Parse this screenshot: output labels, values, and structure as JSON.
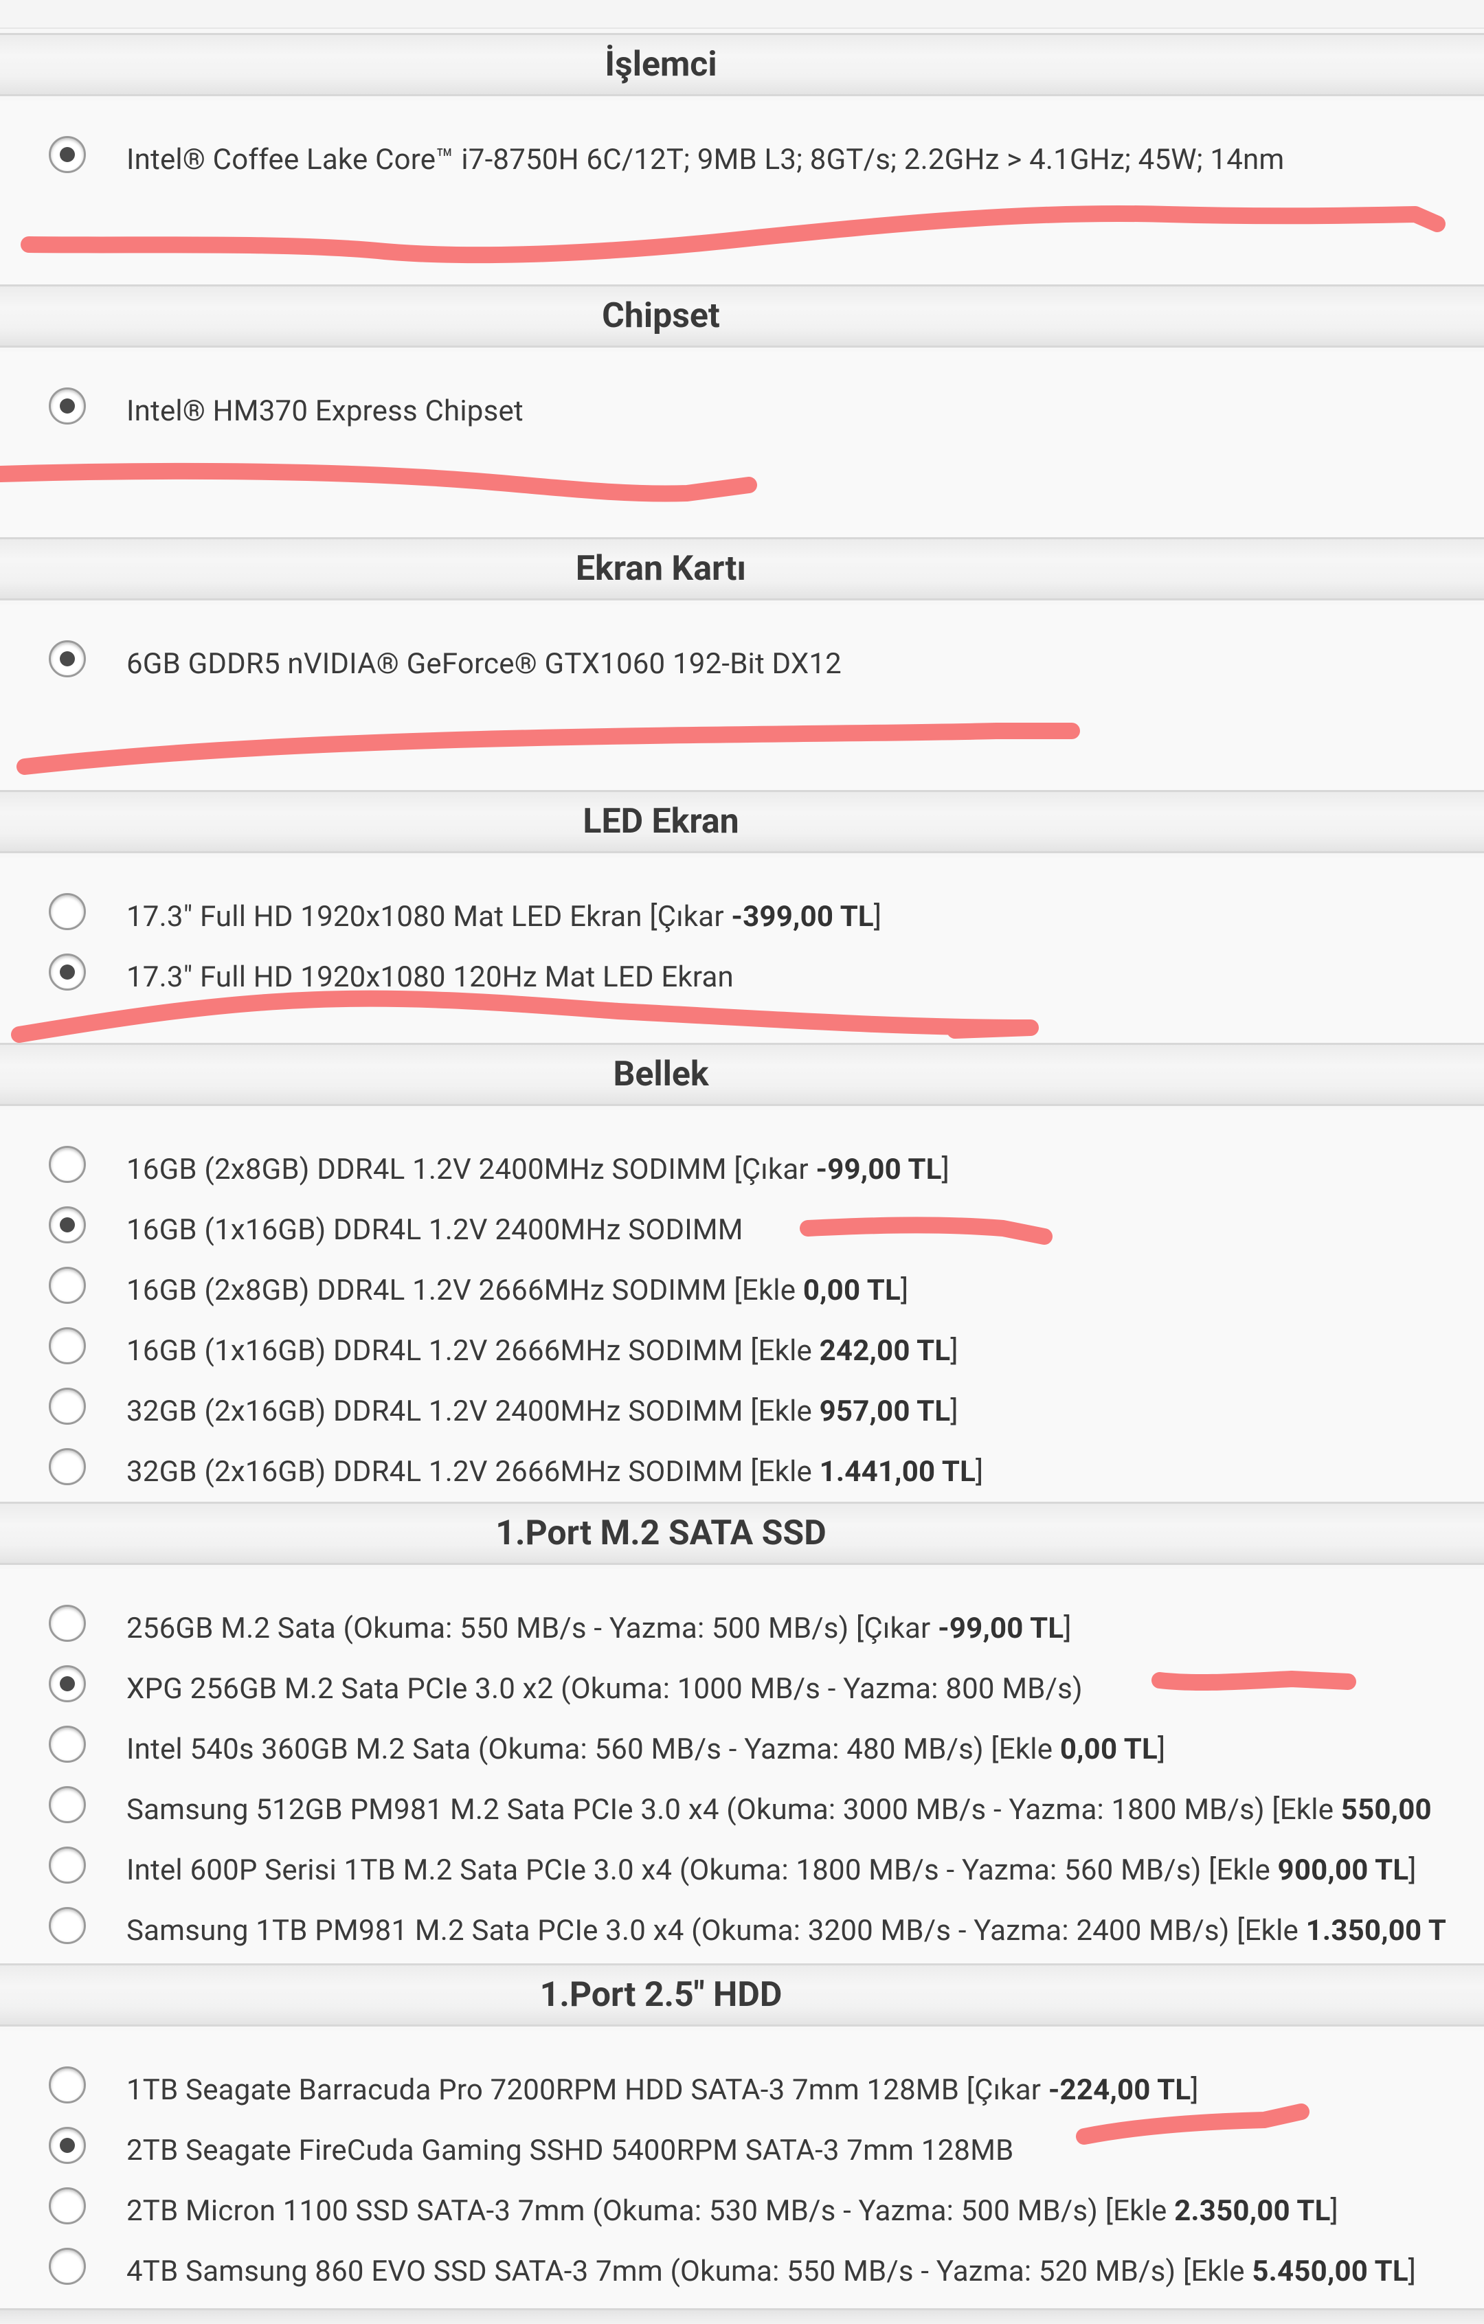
{
  "sections": [
    {
      "title": "İşlemci",
      "options": [
        {
          "text": "Intel® Coffee Lake Core™ i7-8750H 6C/12T; 9MB L3; 8GT/s; 2.2GHz > 4.1GHz; 45W; 14nm",
          "price_prefix": "",
          "price": "",
          "price_suffix": "",
          "checked": true
        }
      ]
    },
    {
      "title": "Chipset",
      "options": [
        {
          "text": "Intel® HM370 Express Chipset",
          "price_prefix": "",
          "price": "",
          "price_suffix": "",
          "checked": true
        }
      ]
    },
    {
      "title": "Ekran Kartı",
      "options": [
        {
          "text": "6GB GDDR5 nVIDIA® GeForce® GTX1060 192-Bit DX12",
          "price_prefix": "",
          "price": "",
          "price_suffix": "",
          "checked": true
        }
      ]
    },
    {
      "title": "LED Ekran",
      "options": [
        {
          "text": "17.3\" Full HD 1920x1080 Mat LED Ekran",
          "price_prefix": " [Çıkar ",
          "price": "-399,00 TL",
          "price_suffix": "]",
          "checked": false
        },
        {
          "text": "17.3\" Full HD 1920x1080 120Hz Mat LED Ekran",
          "price_prefix": "",
          "price": "",
          "price_suffix": "",
          "checked": true
        }
      ]
    },
    {
      "title": "Bellek",
      "options": [
        {
          "text": "16GB (2x8GB) DDR4L 1.2V 2400MHz SODIMM",
          "price_prefix": " [Çıkar ",
          "price": "-99,00 TL",
          "price_suffix": "]",
          "checked": false
        },
        {
          "text": "16GB (1x16GB) DDR4L 1.2V 2400MHz SODIMM",
          "price_prefix": "",
          "price": "",
          "price_suffix": "",
          "checked": true
        },
        {
          "text": "16GB (2x8GB) DDR4L 1.2V 2666MHz SODIMM",
          "price_prefix": " [Ekle ",
          "price": "0,00 TL",
          "price_suffix": "]",
          "checked": false
        },
        {
          "text": "16GB (1x16GB) DDR4L 1.2V 2666MHz SODIMM",
          "price_prefix": " [Ekle ",
          "price": "242,00 TL",
          "price_suffix": "]",
          "checked": false
        },
        {
          "text": "32GB (2x16GB) DDR4L 1.2V 2400MHz SODIMM",
          "price_prefix": " [Ekle ",
          "price": "957,00 TL",
          "price_suffix": "]",
          "checked": false
        },
        {
          "text": "32GB (2x16GB) DDR4L 1.2V 2666MHz SODIMM",
          "price_prefix": " [Ekle ",
          "price": "1.441,00 TL",
          "price_suffix": "]",
          "checked": false
        }
      ]
    },
    {
      "title": "1.Port M.2 SATA SSD",
      "options": [
        {
          "text": "256GB M.2 Sata (Okuma: 550 MB/s - Yazma: 500 MB/s)",
          "price_prefix": " [Çıkar ",
          "price": "-99,00 TL",
          "price_suffix": "]",
          "checked": false
        },
        {
          "text": "XPG 256GB M.2 Sata PCIe 3.0 x2 (Okuma: 1000 MB/s - Yazma: 800 MB/s)",
          "price_prefix": "",
          "price": "",
          "price_suffix": "",
          "checked": true
        },
        {
          "text": "Intel 540s 360GB M.2 Sata (Okuma: 560 MB/s - Yazma: 480 MB/s)",
          "price_prefix": " [Ekle ",
          "price": "0,00 TL",
          "price_suffix": "]",
          "checked": false
        },
        {
          "text": "Samsung 512GB PM981 M.2 Sata PCIe 3.0 x4 (Okuma: 3000 MB/s - Yazma: 1800 MB/s)",
          "price_prefix": " [Ekle ",
          "price": "550,00",
          "price_suffix": "",
          "checked": false
        },
        {
          "text": "Intel 600P Serisi 1TB M.2 Sata PCIe 3.0 x4 (Okuma: 1800 MB/s - Yazma: 560 MB/s)",
          "price_prefix": " [Ekle ",
          "price": "900,00 TL",
          "price_suffix": "]",
          "checked": false
        },
        {
          "text": "Samsung 1TB PM981 M.2 Sata PCIe 3.0 x4 (Okuma: 3200 MB/s - Yazma: 2400 MB/s)",
          "price_prefix": " [Ekle ",
          "price": "1.350,00 T",
          "price_suffix": "",
          "checked": false
        }
      ]
    },
    {
      "title": "1.Port 2.5\" HDD",
      "options": [
        {
          "text": "1TB Seagate Barracuda Pro 7200RPM HDD SATA-3 7mm 128MB",
          "price_prefix": " [Çıkar ",
          "price": "-224,00 TL",
          "price_suffix": "]",
          "checked": false
        },
        {
          "text": "2TB Seagate FireCuda Gaming SSHD 5400RPM SATA-3 7mm 128MB",
          "price_prefix": "",
          "price": "",
          "price_suffix": "",
          "checked": true
        },
        {
          "text": "2TB Micron 1100 SSD SATA-3 7mm (Okuma: 530 MB/s - Yazma: 500 MB/s)",
          "price_prefix": " [Ekle ",
          "price": "2.350,00 TL",
          "price_suffix": "]",
          "checked": false
        },
        {
          "text": "4TB Samsung 860 EVO SSD SATA-3 7mm (Okuma: 550 MB/s - Yazma: 520 MB/s)",
          "price_prefix": " [Ekle ",
          "price": "5.450,00 TL",
          "price_suffix": "]",
          "checked": false
        }
      ]
    }
  ],
  "accent": {
    "scribble": "#f77b7b",
    "header_text": "#3a3a3a",
    "radio_dot": "#4a4a4a"
  }
}
